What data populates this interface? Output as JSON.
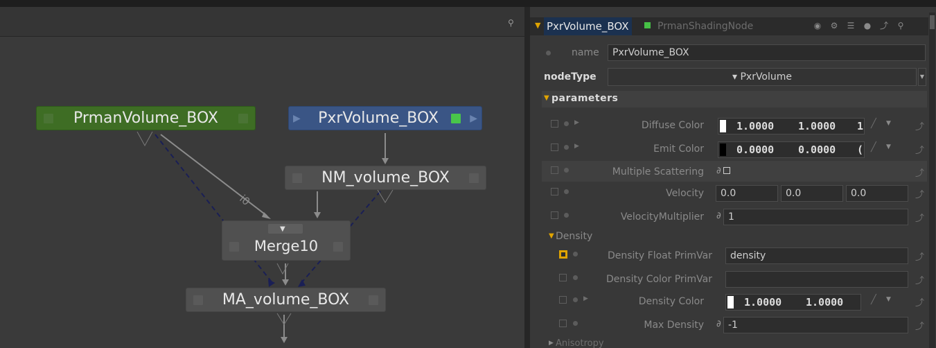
{
  "graph": {
    "nodes": {
      "prman": {
        "label": "PrmanVolume_BOX"
      },
      "pxr": {
        "label": "PxrVolume_BOX"
      },
      "nm": {
        "label": "NM_volume_BOX"
      },
      "merge": {
        "label": "Merge10"
      },
      "ma": {
        "label": "MA_volume_BOX"
      }
    },
    "wire_label": "i0"
  },
  "panel": {
    "header": {
      "title": "PxrVolume_BOX",
      "type": "PrmanShadingNode"
    },
    "name_label": "name",
    "name_value": "PxrVolume_BOX",
    "nodetype_label": "nodeType",
    "nodetype_value": "▾ PxrVolume",
    "parameters_label": "parameters",
    "params": {
      "diffuse": {
        "label": "Diffuse Color",
        "v1": "1.0000",
        "v2": "1.0000",
        "v3": "1"
      },
      "emit": {
        "label": "Emit Color",
        "v1": "0.0000",
        "v2": "0.0000",
        "v3": "("
      },
      "multi": {
        "label": "Multiple Scattering"
      },
      "velocity": {
        "label": "Velocity",
        "v1": "0.0",
        "v2": "0.0",
        "v3": "0.0"
      },
      "velmult": {
        "label": "VelocityMultiplier",
        "value": "1"
      }
    },
    "density": {
      "section_label": "Density",
      "floatprim": {
        "label": "Density Float PrimVar",
        "value": "density"
      },
      "colorprim": {
        "label": "Density Color PrimVar",
        "value": ""
      },
      "color": {
        "label": "Density Color",
        "v1": "1.0000",
        "v2": "1.0000"
      },
      "maxdens": {
        "label": "Max Density",
        "value": "-1"
      }
    },
    "anisotropy_label": "Anisotropy"
  },
  "colors": {
    "prman_node": "#3e6d24",
    "pxr_node": "#3a5585",
    "accent": "#e0a400",
    "header_title_bg": "#1b3150"
  }
}
